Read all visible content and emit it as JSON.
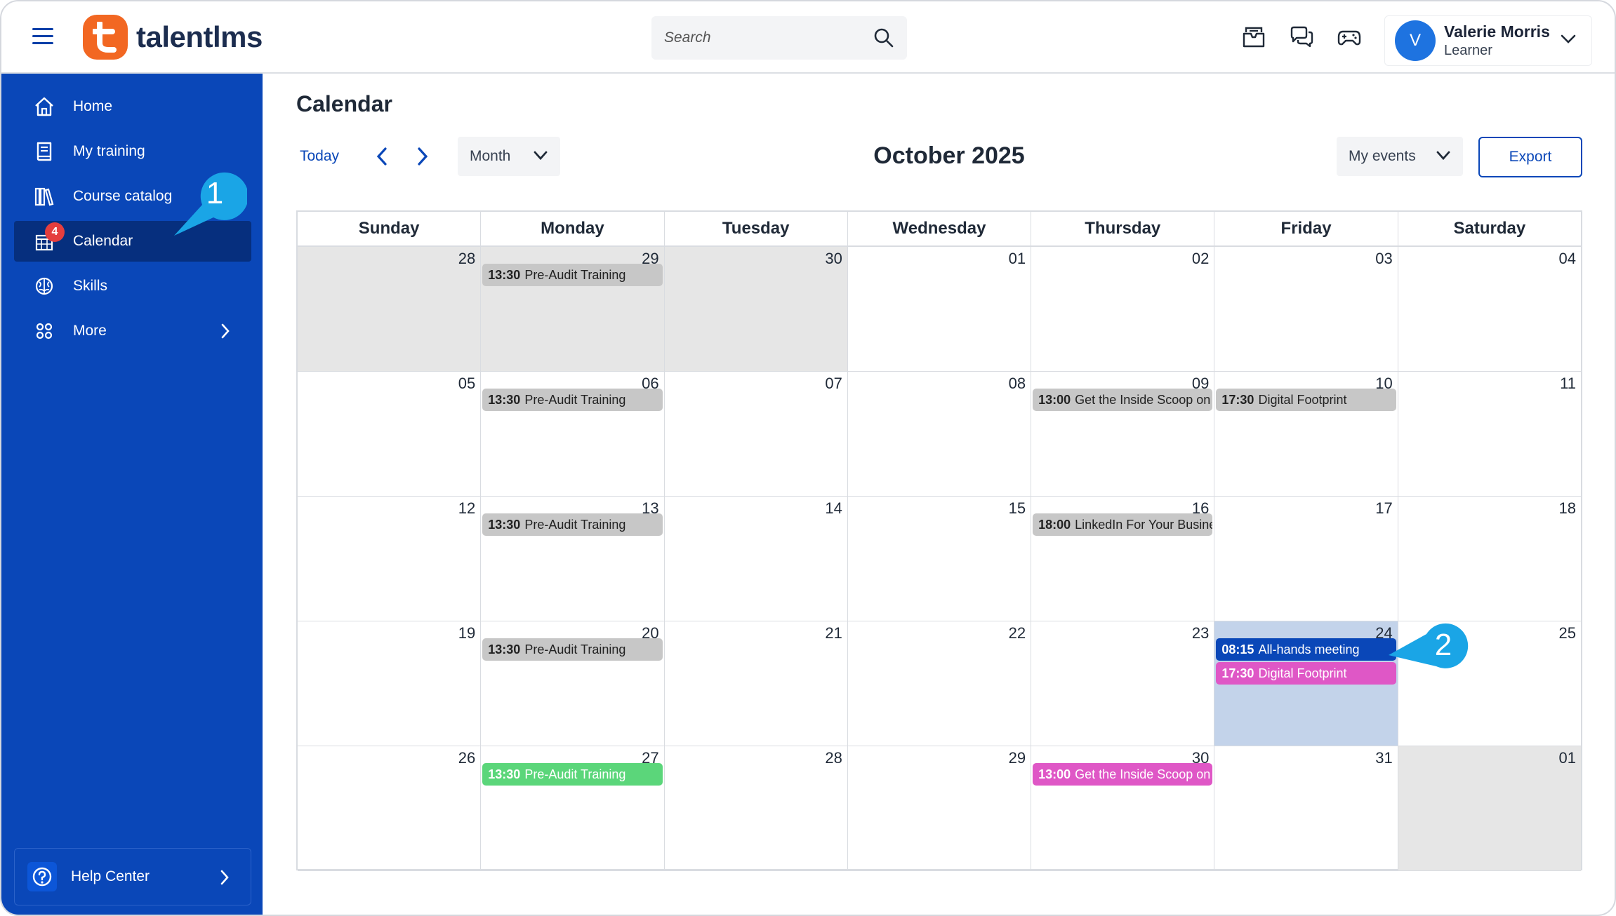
{
  "header": {
    "brand": "talentlms",
    "search_placeholder": "Search",
    "user": {
      "initial": "V",
      "name": "Valerie Morris",
      "role": "Learner"
    }
  },
  "sidebar": {
    "items": [
      {
        "label": "Home",
        "icon": "home-icon"
      },
      {
        "label": "My training",
        "icon": "book-icon"
      },
      {
        "label": "Course catalog",
        "icon": "library-icon"
      },
      {
        "label": "Calendar",
        "icon": "calendar-icon",
        "badge": "4",
        "active": true
      },
      {
        "label": "Skills",
        "icon": "brain-icon"
      },
      {
        "label": "More",
        "icon": "grid-icon"
      }
    ],
    "help": "Help Center"
  },
  "toolbar": {
    "page_title": "Calendar",
    "today": "Today",
    "view": "Month",
    "month_title": "October 2025",
    "events_filter": "My events",
    "export": "Export"
  },
  "calendar": {
    "weekdays": [
      "Sunday",
      "Monday",
      "Tuesday",
      "Wednesday",
      "Thursday",
      "Friday",
      "Saturday"
    ],
    "weeks": [
      [
        {
          "num": "28",
          "outside": true
        },
        {
          "num": "29",
          "outside": true,
          "events": [
            {
              "time": "13:30",
              "title": "Pre-Audit Training",
              "color": "gray"
            }
          ]
        },
        {
          "num": "30",
          "outside": true
        },
        {
          "num": "01"
        },
        {
          "num": "02"
        },
        {
          "num": "03"
        },
        {
          "num": "04"
        }
      ],
      [
        {
          "num": "05"
        },
        {
          "num": "06",
          "events": [
            {
              "time": "13:30",
              "title": "Pre-Audit Training",
              "color": "gray"
            }
          ]
        },
        {
          "num": "07"
        },
        {
          "num": "08"
        },
        {
          "num": "09",
          "events": [
            {
              "time": "13:00",
              "title": "Get the Inside Scoop on",
              "color": "gray"
            }
          ]
        },
        {
          "num": "10",
          "events": [
            {
              "time": "17:30",
              "title": "Digital Footprint",
              "color": "gray"
            }
          ]
        },
        {
          "num": "11"
        }
      ],
      [
        {
          "num": "12"
        },
        {
          "num": "13",
          "events": [
            {
              "time": "13:30",
              "title": "Pre-Audit Training",
              "color": "gray"
            }
          ]
        },
        {
          "num": "14"
        },
        {
          "num": "15"
        },
        {
          "num": "16",
          "events": [
            {
              "time": "18:00",
              "title": "LinkedIn For Your Busine",
              "color": "gray"
            }
          ]
        },
        {
          "num": "17"
        },
        {
          "num": "18"
        }
      ],
      [
        {
          "num": "19"
        },
        {
          "num": "20",
          "events": [
            {
              "time": "13:30",
              "title": "Pre-Audit Training",
              "color": "gray"
            }
          ]
        },
        {
          "num": "21"
        },
        {
          "num": "22"
        },
        {
          "num": "23"
        },
        {
          "num": "24",
          "highlight": true,
          "events": [
            {
              "time": "08:15",
              "title": "All-hands meeting",
              "color": "blue"
            },
            {
              "time": "17:30",
              "title": "Digital Footprint",
              "color": "pink"
            }
          ]
        },
        {
          "num": "25"
        }
      ],
      [
        {
          "num": "26"
        },
        {
          "num": "27",
          "events": [
            {
              "time": "13:30",
              "title": "Pre-Audit Training",
              "color": "green"
            }
          ]
        },
        {
          "num": "28"
        },
        {
          "num": "29"
        },
        {
          "num": "30",
          "events": [
            {
              "time": "13:00",
              "title": "Get the Inside Scoop on",
              "color": "pink"
            }
          ]
        },
        {
          "num": "31"
        },
        {
          "num": "01",
          "outside": true
        }
      ]
    ]
  },
  "callouts": [
    {
      "label": "1"
    },
    {
      "label": "2"
    }
  ],
  "colors": {
    "sidebar": "#0a47b8",
    "sidebar_active": "#062f7e",
    "brand_orange": "#f26722",
    "callout": "#1aa5e6",
    "event_blue": "#0a47b8",
    "event_pink": "#df57c6",
    "event_green": "#5bd67a",
    "event_gray": "#c7c7c7"
  }
}
